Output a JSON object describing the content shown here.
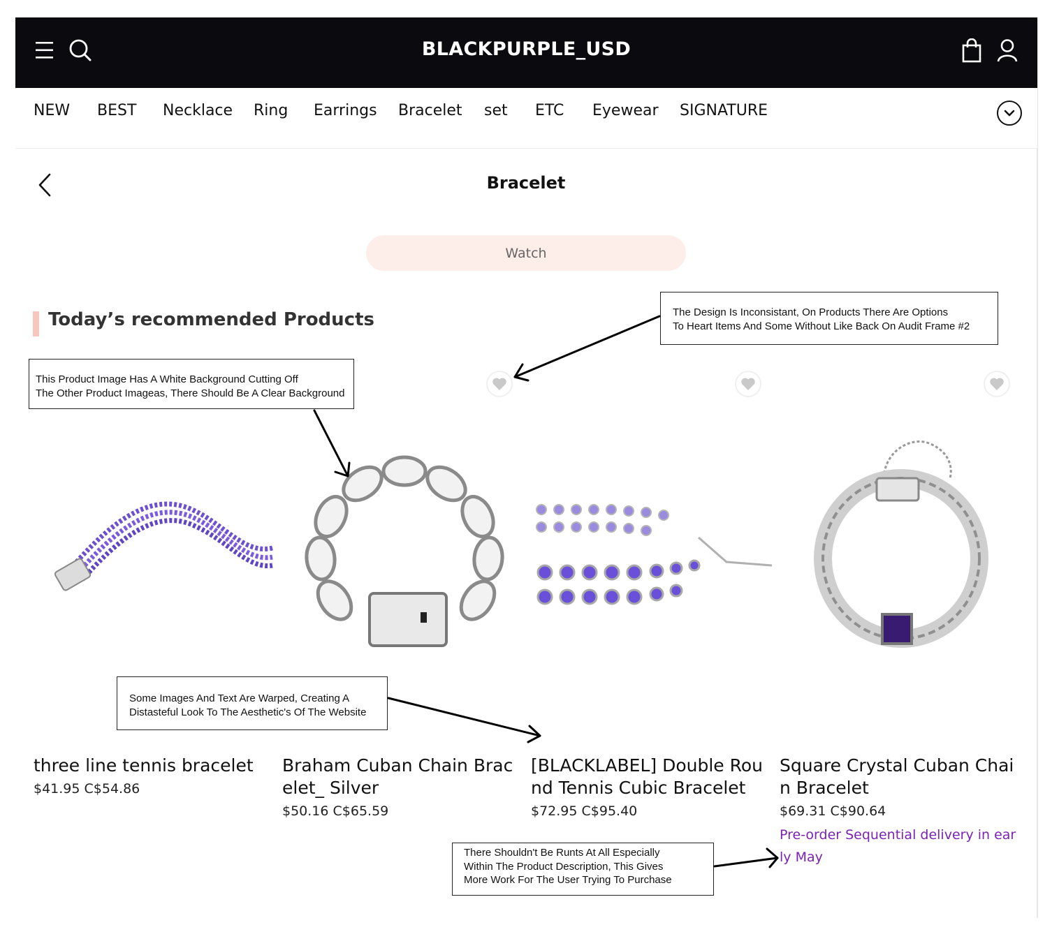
{
  "header": {
    "brand": "BLACKPURPLE_USD",
    "icons": [
      "menu-icon",
      "search-icon",
      "shopping-bag-icon",
      "user-icon"
    ],
    "background": "#0b0b0f"
  },
  "category_nav": {
    "items": [
      "NEW",
      "BEST",
      "Necklace",
      "Ring",
      "Earrings",
      "Bracelet",
      "set",
      "ETC",
      "Eyewear",
      "SIGNATURE"
    ],
    "expand_icon": "chevron-down-circle-icon"
  },
  "page": {
    "title": "Bracelet",
    "back_icon": "chevron-left-icon",
    "watch_button": "Watch"
  },
  "recommended": {
    "title": "Today’s recommended Products",
    "accent_color": "#f7c6bc",
    "products": [
      {
        "name": "three line tennis bracelet",
        "price": "$41.95 C$54.86",
        "has_heart": false
      },
      {
        "name": "Braham Cuban Chain Bracelet_ Silver",
        "price": "$50.16 C$65.59",
        "has_heart": true
      },
      {
        "name": "[BLACKLABEL] Double Round Tennis Cubic Bracelet",
        "price": "$72.95 C$95.40",
        "has_heart": true
      },
      {
        "name": "Square Crystal Cuban Chain Bracelet",
        "price": "$69.31 C$90.64",
        "has_heart": true,
        "note": "Pre-order Sequential delivery in early May",
        "note_color": "#7b22b8"
      }
    ]
  },
  "annotations": [
    {
      "text": "The Design Is Inconsistant, On Products There Are Options\nTo Heart Items And Some Without Like Back On Audit Frame #2"
    },
    {
      "text": "This Product Image Has A White Background Cutting Off\nThe Other Product Imageas, There Should Be A Clear Background"
    },
    {
      "text": "Some Images And Text Are Warped, Creating A\nDistasteful Look To The Aesthetic's Of The Website"
    },
    {
      "text": "There Shouldn't Be Runts At All Especially\nWithin The Product Description, This Gives\nMore Work For The User Trying To Purchase"
    }
  ]
}
